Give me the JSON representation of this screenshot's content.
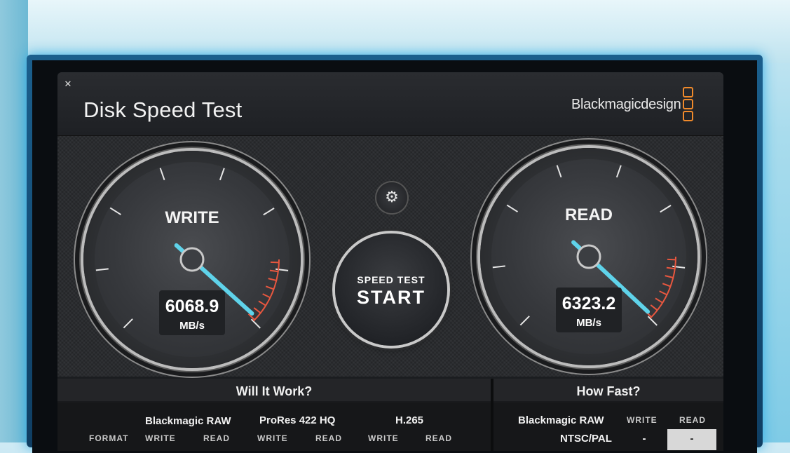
{
  "app": {
    "title": "Disk Speed Test",
    "brand": "Blackmagicdesign",
    "close_icon": "close-icon",
    "accent_color": "#f08a2b"
  },
  "write_gauge": {
    "label": "WRITE",
    "value": "6068.9",
    "unit": "MB/s",
    "needle_color": "#5fd3ea",
    "redline_color": "#e8573f"
  },
  "read_gauge": {
    "label": "READ",
    "value": "6323.2",
    "unit": "MB/s",
    "needle_color": "#5fd3ea",
    "redline_color": "#e8573f"
  },
  "controls": {
    "settings_icon": "gear-icon",
    "start_line1": "SPEED TEST",
    "start_line2": "START"
  },
  "will_it_work": {
    "title": "Will It Work?",
    "format_label": "FORMAT",
    "codecs": [
      {
        "name": "Blackmagic RAW",
        "write": "WRITE",
        "read": "READ"
      },
      {
        "name": "ProRes 422 HQ",
        "write": "WRITE",
        "read": "READ"
      },
      {
        "name": "H.265",
        "write": "WRITE",
        "read": "READ"
      }
    ]
  },
  "how_fast": {
    "title": "How Fast?",
    "codec": "Blackmagic RAW",
    "write_label": "WRITE",
    "read_label": "READ",
    "row_label": "NTSC/PAL",
    "row_write": "-",
    "row_read": "-"
  }
}
